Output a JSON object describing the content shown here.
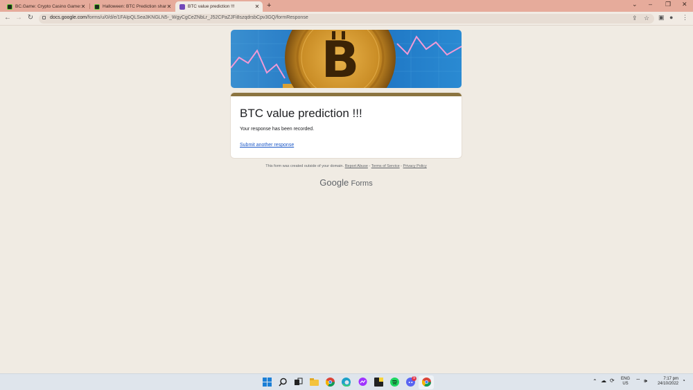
{
  "browser": {
    "tabs": [
      {
        "title": "BC.Game: Crypto Casino Games &",
        "active": false,
        "favicon": "bc-game-icon"
      },
      {
        "title": "Halloween: BTC Prediction share",
        "active": false,
        "favicon": "bc-game-icon"
      },
      {
        "title": "BTC value prediction !!!",
        "active": true,
        "favicon": "google-forms-icon"
      }
    ],
    "new_tab": "+",
    "url_host": "docs.google.com",
    "url_path": "/forms/u/0/d/e/1FAIpQLSea3KNGLN5-_WgyCgCeZNbLr_J52CPaZJFi8szqdrsbCpv3GQ/formResponse"
  },
  "form": {
    "title": "BTC value prediction !!!",
    "confirmation": "Your response has been recorded.",
    "submit_another": "Submit another response"
  },
  "footer": {
    "notice": "This form was created outside of your domain.",
    "report_abuse": "Report Abuse",
    "terms": "Terms of Service",
    "privacy": "Privacy Policy",
    "sep": " - "
  },
  "brand": {
    "google": "Google",
    "forms": "Forms"
  },
  "taskbar": {
    "apps": [
      "windows-start-icon",
      "search-icon",
      "task-view-icon",
      "file-explorer-icon",
      "chrome-icon",
      "edge-icon",
      "messenger-icon",
      "sticky-notes-icon",
      "spotify-icon",
      "discord-icon",
      "chrome-active-icon"
    ],
    "lang": "ENG",
    "region": "US",
    "time": "7:17 pm",
    "date": "24/10/2022",
    "discord_badge": "9"
  },
  "colors": {
    "accent": "#8b7440",
    "tabbar": "#e6ab9b",
    "page_bg": "#f0ebe3",
    "link": "#1a57c7"
  }
}
